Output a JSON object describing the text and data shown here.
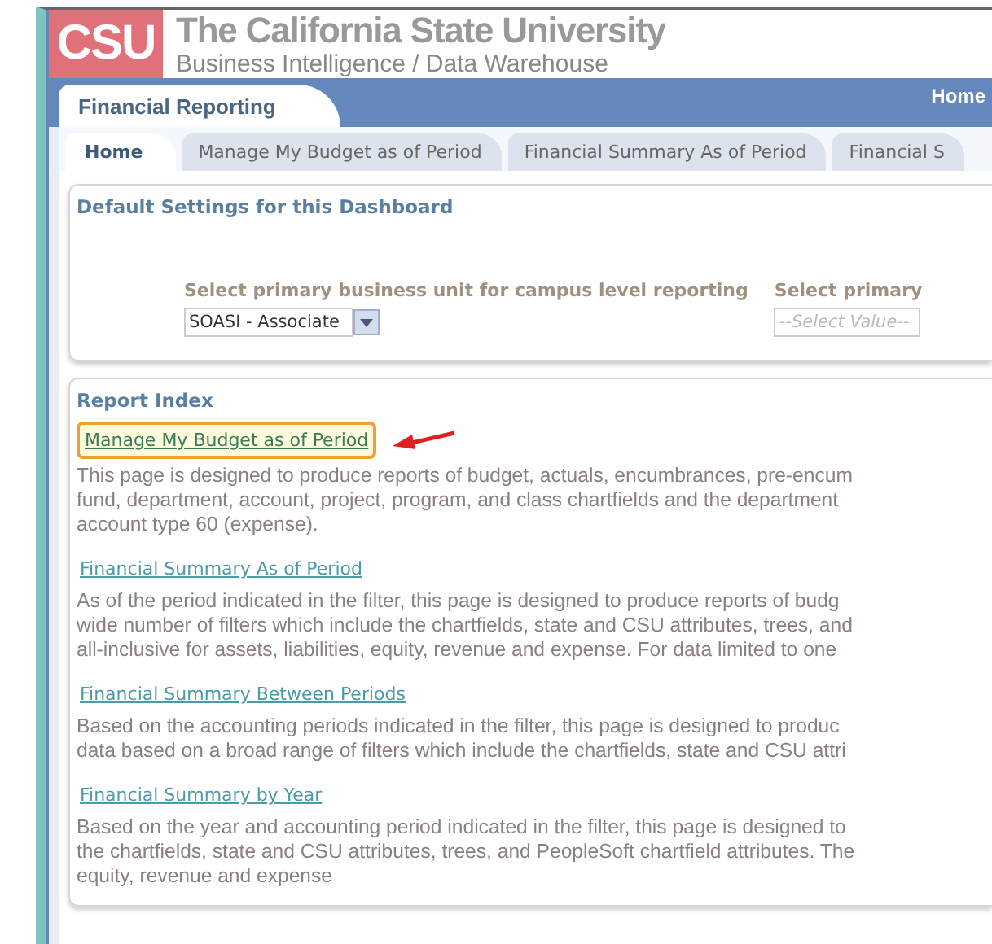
{
  "header": {
    "logo": "CSU",
    "title": "The California State University",
    "subtitle": "Business Intelligence / Data Warehouse"
  },
  "dashboard": {
    "title": "Financial Reporting",
    "home_link": "Home"
  },
  "tabs": [
    {
      "label": "Home",
      "selected": true
    },
    {
      "label": "Manage My Budget as of Period",
      "selected": false
    },
    {
      "label": "Financial Summary As of Period",
      "selected": false
    },
    {
      "label": "Financial S",
      "selected": false
    }
  ],
  "settings": {
    "title": "Default Settings for this Dashboard",
    "prompts": [
      {
        "label": "Select primary business unit for campus level reporting",
        "value": "SOASI - Associate"
      },
      {
        "label": "Select primary",
        "placeholder": "--Select Value--"
      }
    ]
  },
  "report_index": {
    "title": "Report Index",
    "reports": [
      {
        "link": "Manage My Budget as of Period",
        "highlighted": true,
        "lines": [
          "This page is designed to produce reports of budget, actuals, encumbrances, pre-encum",
          "fund, department, account, project, program, and class chartfields and the department",
          "account type 60 (expense)."
        ]
      },
      {
        "link": "Financial Summary As of Period",
        "highlighted": false,
        "lines": [
          "As of the period indicated in the filter, this page is designed to produce reports of budg",
          "wide number of filters which include the chartfields, state and CSU attributes, trees, and",
          "all-inclusive for assets, liabilities, equity, revenue and expense. For data limited to one"
        ]
      },
      {
        "link": "Financial Summary Between Periods",
        "highlighted": false,
        "lines": [
          "Based on the accounting periods indicated in the filter, this page is designed to produc",
          "data based on a broad range of filters which include the chartfields, state and CSU attri"
        ]
      },
      {
        "link": "Financial Summary by Year",
        "highlighted": false,
        "lines": [
          "Based on the year and accounting period indicated in the filter, this page is designed to",
          "the chartfields, state and CSU attributes, trees, and PeopleSoft chartfield attributes. The",
          "equity, revenue and expense"
        ]
      }
    ]
  }
}
